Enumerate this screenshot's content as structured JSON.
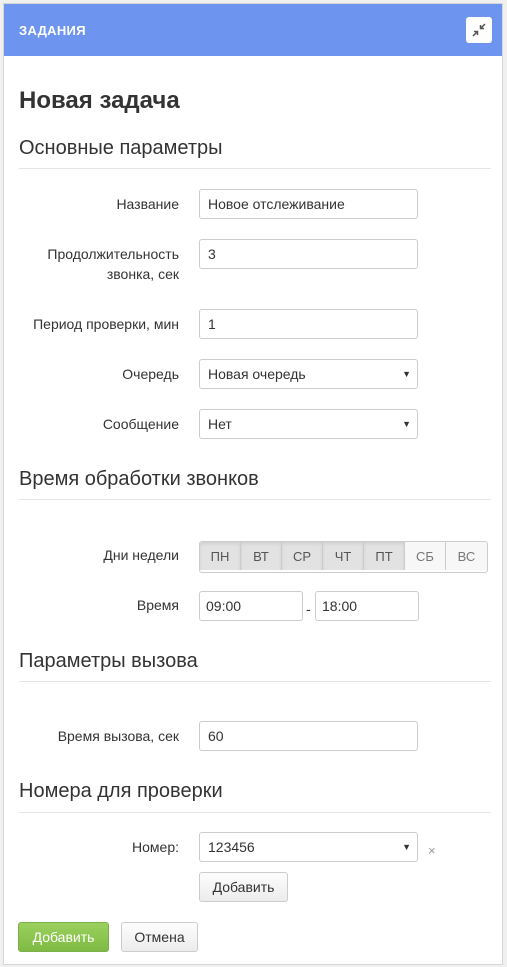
{
  "header": {
    "title": "ЗАДАНИЯ",
    "collapse_icon": "collapse-icon"
  },
  "page": {
    "title": "Новая задача"
  },
  "sections": {
    "basic": "Основные параметры",
    "call_processing": "Время обработки звонков",
    "call_params": "Параметры вызова",
    "numbers": "Номера для проверки"
  },
  "fields": {
    "name": {
      "label": "Название",
      "value": "Новое отслеживание"
    },
    "ring_duration": {
      "label_line1": "Продолжительность",
      "label_line2": "звонка, сек",
      "value": "3"
    },
    "check_period": {
      "label": "Период проверки, мин",
      "value": "1"
    },
    "queue": {
      "label": "Очередь",
      "value": "Новая очередь"
    },
    "message": {
      "label": "Сообщение",
      "value": "Нет"
    },
    "weekdays": {
      "label": "Дни недели",
      "days": [
        {
          "label": "ПН",
          "active": true
        },
        {
          "label": "ВТ",
          "active": true
        },
        {
          "label": "СР",
          "active": true
        },
        {
          "label": "ЧТ",
          "active": true
        },
        {
          "label": "ПТ",
          "active": true
        },
        {
          "label": "СБ",
          "active": false
        },
        {
          "label": "ВС",
          "active": false
        }
      ]
    },
    "time": {
      "label": "Время",
      "from": "09:00",
      "separator": "-",
      "to": "18:00"
    },
    "call_time": {
      "label": "Время вызова, сек",
      "value": "60"
    },
    "number": {
      "label": "Номер:",
      "value": "123456",
      "remove": "×"
    }
  },
  "buttons": {
    "add_number": "Добавить",
    "submit": "Добавить",
    "cancel": "Отмена"
  },
  "colors": {
    "header": "#6d94ee",
    "submit": "#85c04a"
  }
}
